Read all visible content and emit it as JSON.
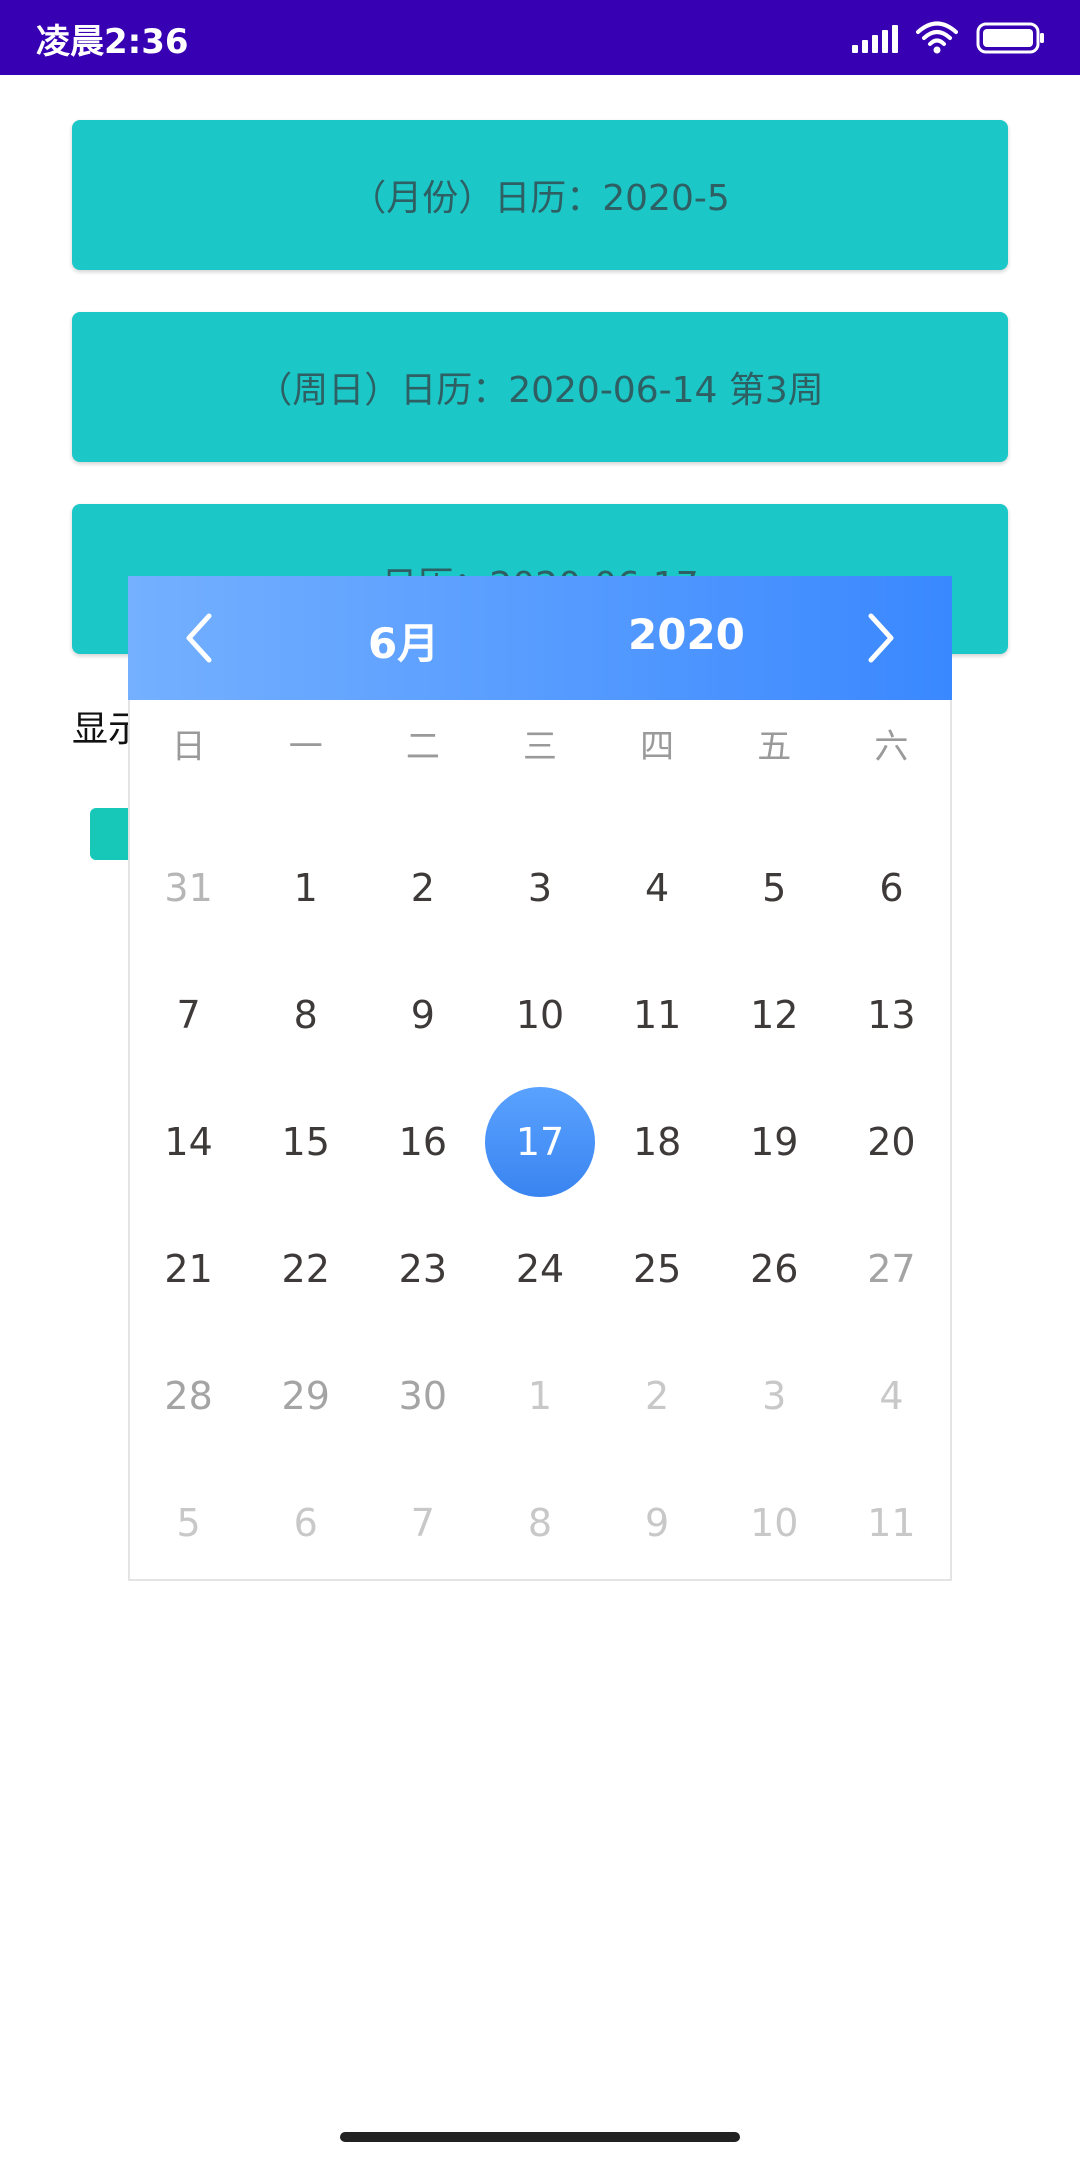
{
  "status_bar": {
    "time": "凌晨2:36",
    "icons": [
      "signal-icon",
      "wifi-icon",
      "battery-icon"
    ],
    "background": "#3700b3"
  },
  "buttons": {
    "month_calendar": "（月份）日历：2020-5",
    "week_calendar": "（周日）日历：2020-06-14 第3周",
    "day_calendar": "日历：2020-06-17"
  },
  "show_label": "显示",
  "checkbox": {
    "checked": true,
    "color": "#17c8b9"
  },
  "calendar": {
    "month": "6月",
    "year": "2020",
    "prev_icon": "chevron-left-icon",
    "next_icon": "chevron-right-icon",
    "header_gradient": [
      "#74b0ff",
      "#3a88ff"
    ],
    "weekdays": [
      "日",
      "一",
      "二",
      "三",
      "四",
      "五",
      "六"
    ],
    "selected_day": "17",
    "days": [
      {
        "label": "31",
        "state": "other"
      },
      {
        "label": "1",
        "state": "current"
      },
      {
        "label": "2",
        "state": "current"
      },
      {
        "label": "3",
        "state": "current"
      },
      {
        "label": "4",
        "state": "current"
      },
      {
        "label": "5",
        "state": "current"
      },
      {
        "label": "6",
        "state": "current"
      },
      {
        "label": "7",
        "state": "current"
      },
      {
        "label": "8",
        "state": "current"
      },
      {
        "label": "9",
        "state": "current"
      },
      {
        "label": "10",
        "state": "current"
      },
      {
        "label": "11",
        "state": "current"
      },
      {
        "label": "12",
        "state": "current"
      },
      {
        "label": "13",
        "state": "current"
      },
      {
        "label": "14",
        "state": "current"
      },
      {
        "label": "15",
        "state": "current"
      },
      {
        "label": "16",
        "state": "current"
      },
      {
        "label": "17",
        "state": "selected"
      },
      {
        "label": "18",
        "state": "current"
      },
      {
        "label": "19",
        "state": "current"
      },
      {
        "label": "20",
        "state": "current"
      },
      {
        "label": "21",
        "state": "current"
      },
      {
        "label": "22",
        "state": "current"
      },
      {
        "label": "23",
        "state": "current"
      },
      {
        "label": "24",
        "state": "current"
      },
      {
        "label": "25",
        "state": "current"
      },
      {
        "label": "26",
        "state": "current"
      },
      {
        "label": "27",
        "state": "dim"
      },
      {
        "label": "28",
        "state": "dim"
      },
      {
        "label": "29",
        "state": "dim"
      },
      {
        "label": "30",
        "state": "dim"
      },
      {
        "label": "1",
        "state": "other"
      },
      {
        "label": "2",
        "state": "other"
      },
      {
        "label": "3",
        "state": "other"
      },
      {
        "label": "4",
        "state": "other"
      },
      {
        "label": "5",
        "state": "other"
      },
      {
        "label": "6",
        "state": "other"
      },
      {
        "label": "7",
        "state": "other"
      },
      {
        "label": "8",
        "state": "other"
      },
      {
        "label": "9",
        "state": "other"
      },
      {
        "label": "10",
        "state": "other"
      },
      {
        "label": "11",
        "state": "other"
      }
    ]
  }
}
